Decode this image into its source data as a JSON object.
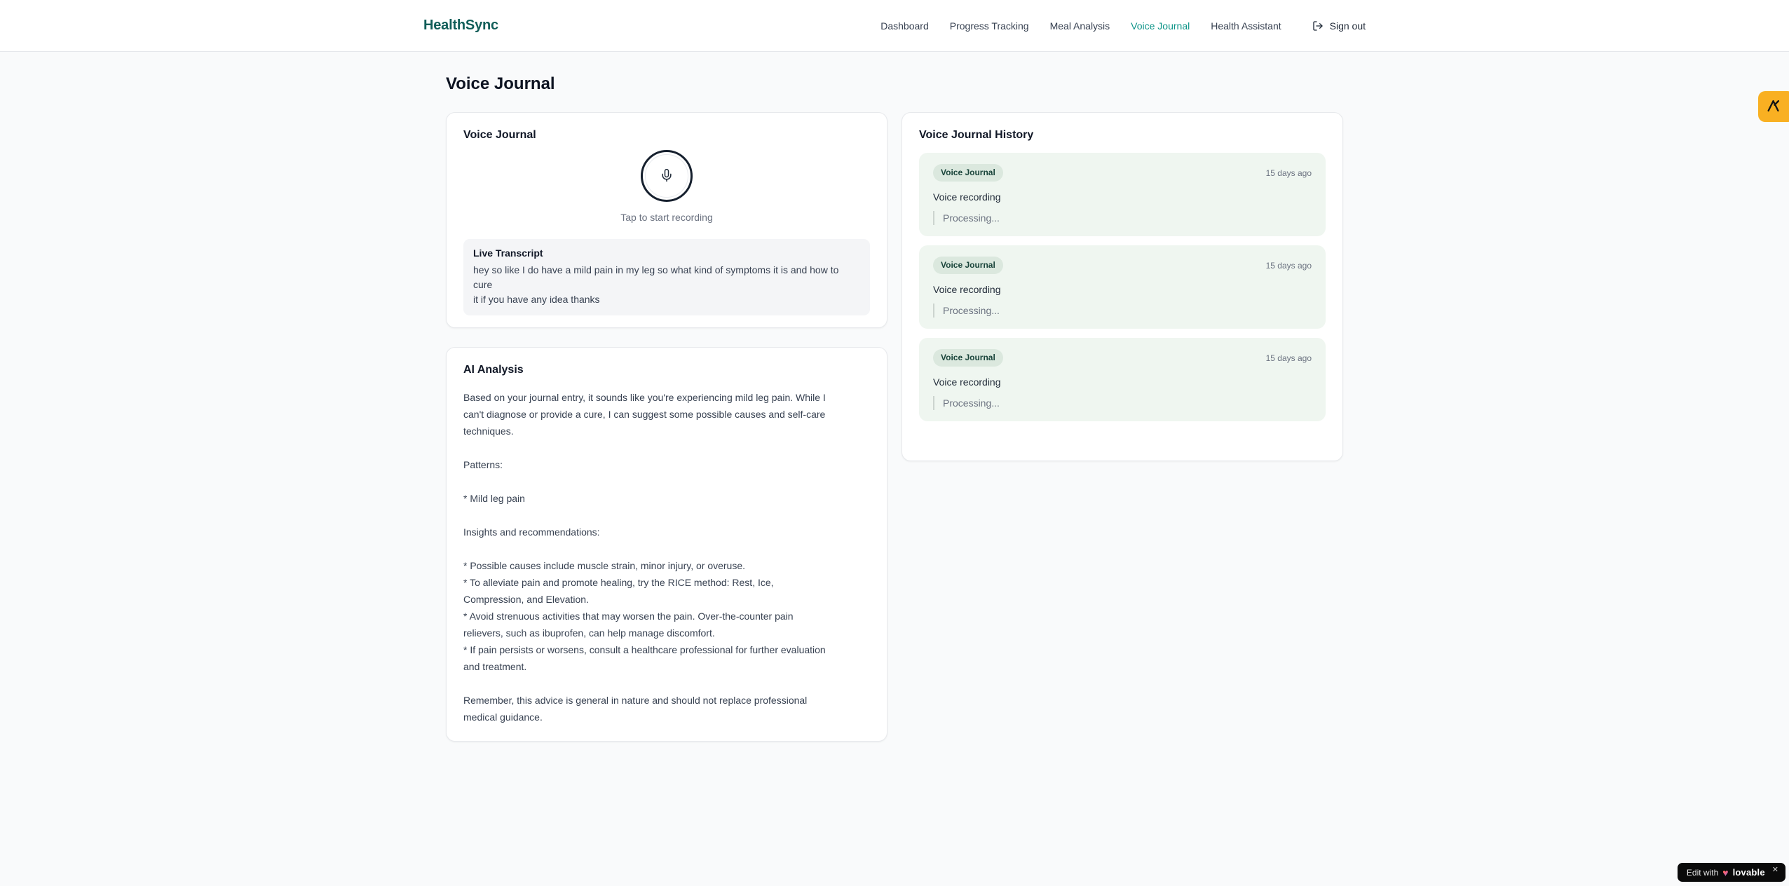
{
  "brand": {
    "name": "HealthSync"
  },
  "nav": {
    "items": [
      {
        "label": "Dashboard",
        "active": false
      },
      {
        "label": "Progress Tracking",
        "active": false
      },
      {
        "label": "Meal Analysis",
        "active": false
      },
      {
        "label": "Voice Journal",
        "active": true
      },
      {
        "label": "Health Assistant",
        "active": false
      }
    ],
    "sign_out_label": "Sign out"
  },
  "page": {
    "title": "Voice Journal"
  },
  "recorder_card": {
    "title": "Voice Journal",
    "tap_hint": "Tap to start recording",
    "transcript_title": "Live Transcript",
    "transcript_text": "hey so like I do have a mild pain in my leg so what kind of symptoms it is and how to cure\nit if you have any idea thanks"
  },
  "analysis_card": {
    "title": "AI Analysis",
    "body": "Based on your journal entry, it sounds like you're experiencing mild leg pain. While I\ncan't diagnose or provide a cure, I can suggest some possible causes and self-care\ntechniques.\n\nPatterns:\n\n* Mild leg pain\n\nInsights and recommendations:\n\n* Possible causes include muscle strain, minor injury, or overuse.\n* To alleviate pain and promote healing, try the RICE method: Rest, Ice,\nCompression, and Elevation.\n* Avoid strenuous activities that may worsen the pain. Over-the-counter pain\nrelievers, such as ibuprofen, can help manage discomfort.\n* If pain persists or worsens, consult a healthcare professional for further evaluation\nand treatment.\n\nRemember, this advice is general in nature and should not replace professional\nmedical guidance."
  },
  "history": {
    "title": "Voice Journal History",
    "entries": [
      {
        "badge": "Voice Journal",
        "time": "15 days ago",
        "label": "Voice recording",
        "status": "Processing..."
      },
      {
        "badge": "Voice Journal",
        "time": "15 days ago",
        "label": "Voice recording",
        "status": "Processing..."
      },
      {
        "badge": "Voice Journal",
        "time": "15 days ago",
        "label": "Voice recording",
        "status": "Processing..."
      }
    ]
  },
  "widgets": {
    "edit_badge": {
      "prefix": "Edit with",
      "heart": "♥",
      "brand": "lovable",
      "close": "✕"
    }
  },
  "colors": {
    "brand_logo": "#115e59",
    "nav_active": "#0d9488",
    "entry_bg": "#eff6f0",
    "entry_badge_bg": "#dbe8de",
    "entry_badge_text": "#1a453b",
    "side_tab": "#f9b022",
    "edit_badge_bg": "#0a0a0a",
    "page_bg": "#f9fafb"
  }
}
